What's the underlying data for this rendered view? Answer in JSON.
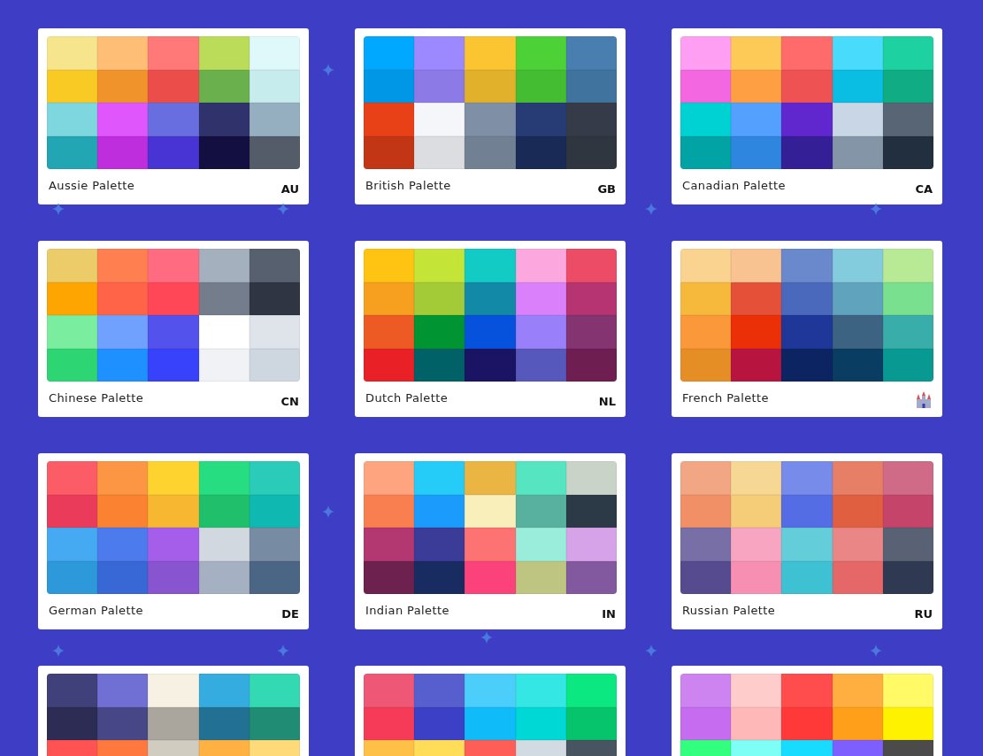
{
  "palettes": [
    {
      "label": "Aussie Palette",
      "badge": {
        "kind": "code",
        "text": "AU"
      },
      "rows": [
        [
          {
            "color": "#f6e58d"
          },
          {
            "color": "#ffbe76"
          },
          {
            "color": "#ff7979"
          },
          {
            "color": "#badc58"
          },
          {
            "color": "#dff9fb"
          }
        ],
        [
          {
            "color": "#f9ca24"
          },
          {
            "color": "#f0932b"
          },
          {
            "color": "#eb4d4b"
          },
          {
            "color": "#6ab04c"
          },
          {
            "color": "#c7ecee"
          }
        ],
        [
          {
            "color": "#7ed6df"
          },
          {
            "color": "#e056fd"
          },
          {
            "color": "#686de0"
          },
          {
            "color": "#30336b"
          },
          {
            "color": "#95afc0"
          }
        ],
        [
          {
            "color": "#22a6b3"
          },
          {
            "color": "#be2edd"
          },
          {
            "color": "#4834d4"
          },
          {
            "color": "#130f40"
          },
          {
            "color": "#535c68"
          }
        ]
      ]
    },
    {
      "label": "British Palette",
      "badge": {
        "kind": "code",
        "text": "GB"
      },
      "rows": [
        [
          {
            "color": "#00a8ff"
          },
          {
            "color": "#9c88ff"
          },
          {
            "color": "#fbc531"
          },
          {
            "color": "#4cd137"
          },
          {
            "color": "#487eb0"
          }
        ],
        [
          {
            "color": "#0097e6"
          },
          {
            "color": "#8c7ae6"
          },
          {
            "color": "#e1b12c"
          },
          {
            "color": "#44bd32"
          },
          {
            "color": "#40739e"
          }
        ],
        [
          {
            "color": "#e84118"
          },
          {
            "color": "#f5f6fa"
          },
          {
            "color": "#7f8fa6"
          },
          {
            "color": "#273c75"
          },
          {
            "color": "#353b48"
          }
        ],
        [
          {
            "color": "#c23616"
          },
          {
            "color": "#dcdde1"
          },
          {
            "color": "#718093"
          },
          {
            "color": "#192a56"
          },
          {
            "color": "#2f3640"
          }
        ]
      ]
    },
    {
      "label": "Canadian Palette",
      "badge": {
        "kind": "code",
        "text": "CA"
      },
      "rows": [
        [
          {
            "color": "#ff9ff3"
          },
          {
            "color": "#feca57"
          },
          {
            "color": "#ff6b6b"
          },
          {
            "color": "#48dbfb"
          },
          {
            "color": "#1dd1a1"
          }
        ],
        [
          {
            "color": "#f368e0"
          },
          {
            "color": "#ff9f43"
          },
          {
            "color": "#ee5253"
          },
          {
            "color": "#0abde3"
          },
          {
            "color": "#10ac84"
          }
        ],
        [
          {
            "color": "#00d2d3"
          },
          {
            "color": "#54a0ff"
          },
          {
            "color": "#5f27cd"
          },
          {
            "color": "#c8d6e5"
          },
          {
            "color": "#576574"
          }
        ],
        [
          {
            "color": "#01a3a4"
          },
          {
            "color": "#2e86de"
          },
          {
            "color": "#341f97"
          },
          {
            "color": "#8395a7"
          },
          {
            "color": "#222f3e"
          }
        ]
      ]
    },
    {
      "label": "Chinese Palette",
      "badge": {
        "kind": "code",
        "text": "CN"
      },
      "rows": [
        [
          {
            "color": "#eccc68"
          },
          {
            "color": "#ff7f50"
          },
          {
            "color": "#ff6b81"
          },
          {
            "color": "#a4b0be"
          },
          {
            "color": "#57606f"
          }
        ],
        [
          {
            "color": "#ffa502"
          },
          {
            "color": "#ff6348"
          },
          {
            "color": "#ff4757"
          },
          {
            "color": "#747d8c"
          },
          {
            "color": "#2f3542"
          }
        ],
        [
          {
            "color": "#7bed9f"
          },
          {
            "color": "#70a1ff"
          },
          {
            "color": "#5352ed"
          },
          {
            "color": "#ffffff"
          },
          {
            "color": "#dfe4ea"
          }
        ],
        [
          {
            "color": "#2ed573"
          },
          {
            "color": "#1e90ff"
          },
          {
            "color": "#3742fa"
          },
          {
            "color": "#f1f2f6"
          },
          {
            "color": "#ced6e0"
          }
        ]
      ]
    },
    {
      "label": "Dutch Palette",
      "badge": {
        "kind": "code",
        "text": "NL"
      },
      "rows": [
        [
          {
            "color": "#ffc312"
          },
          {
            "color": "#c4e538"
          },
          {
            "color": "#12cbc4"
          },
          {
            "color": "#fda7df"
          },
          {
            "color": "#ed4c67"
          }
        ],
        [
          {
            "color": "#f79f1f"
          },
          {
            "color": "#a3cb38"
          },
          {
            "color": "#1289a7"
          },
          {
            "color": "#d980fa"
          },
          {
            "color": "#b53471"
          }
        ],
        [
          {
            "color": "#ee5a24"
          },
          {
            "color": "#009432"
          },
          {
            "color": "#0652dd"
          },
          {
            "color": "#9980fa"
          },
          {
            "color": "#833471"
          }
        ],
        [
          {
            "color": "#ea2027"
          },
          {
            "color": "#006266"
          },
          {
            "color": "#1b1464"
          },
          {
            "color": "#5758bb"
          },
          {
            "color": "#6f1e51"
          }
        ]
      ]
    },
    {
      "label": "French Palette",
      "badge": {
        "kind": "castle"
      },
      "rows": [
        [
          {
            "color": "#fad390"
          },
          {
            "color": "#f8c291"
          },
          {
            "color": "#6a89cc"
          },
          {
            "color": "#82ccdd"
          },
          {
            "color": "#b8e994"
          }
        ],
        [
          {
            "color": "#f6b93b"
          },
          {
            "color": "#e55039"
          },
          {
            "color": "#4a69bd"
          },
          {
            "color": "#60a3bc"
          },
          {
            "color": "#78e08f"
          }
        ],
        [
          {
            "color": "#fa983a"
          },
          {
            "color": "#eb2f06"
          },
          {
            "color": "#1e3799"
          },
          {
            "color": "#3c6382"
          },
          {
            "color": "#38ada9"
          }
        ],
        [
          {
            "color": "#e58e26"
          },
          {
            "color": "#b71540"
          },
          {
            "color": "#0c2461"
          },
          {
            "color": "#0a3d62"
          },
          {
            "color": "#079992"
          }
        ]
      ]
    },
    {
      "label": "German Palette",
      "badge": {
        "kind": "code",
        "text": "DE"
      },
      "rows": [
        [
          {
            "color": "#fc5c65"
          },
          {
            "color": "#fd9644"
          },
          {
            "color": "#fed330"
          },
          {
            "color": "#26de81"
          },
          {
            "color": "#2bcbba"
          }
        ],
        [
          {
            "color": "#eb3b5a"
          },
          {
            "color": "#fa8231"
          },
          {
            "color": "#f7b731"
          },
          {
            "color": "#20bf6b"
          },
          {
            "color": "#0fb9b1"
          }
        ],
        [
          {
            "color": "#45aaf2"
          },
          {
            "color": "#4b7bec"
          },
          {
            "color": "#a55eea"
          },
          {
            "color": "#d1d8e0"
          },
          {
            "color": "#778ca3"
          }
        ],
        [
          {
            "color": "#2d98da"
          },
          {
            "color": "#3867d6"
          },
          {
            "color": "#8854d0"
          },
          {
            "color": "#a5b1c2"
          },
          {
            "color": "#4b6584"
          }
        ]
      ]
    },
    {
      "label": "Indian Palette",
      "badge": {
        "kind": "code",
        "text": "IN"
      },
      "rows": [
        [
          {
            "color": "#fea47f"
          },
          {
            "color": "#25ccf7"
          },
          {
            "color": "#eab543"
          },
          {
            "color": "#55e6c1"
          },
          {
            "color": "#cad3c8"
          }
        ],
        [
          {
            "color": "#f97f51"
          },
          {
            "color": "#1b9cfc"
          },
          {
            "color": "#f8efba"
          },
          {
            "color": "#58b19f"
          },
          {
            "color": "#2c3a47"
          }
        ],
        [
          {
            "color": "#b33771"
          },
          {
            "color": "#3b3b98"
          },
          {
            "color": "#fd7272"
          },
          {
            "color": "#9aecdb"
          },
          {
            "color": "#d6a2e8"
          }
        ],
        [
          {
            "color": "#6d214f"
          },
          {
            "color": "#182c61"
          },
          {
            "color": "#fc427b"
          },
          {
            "color": "#bdc581"
          },
          {
            "color": "#82589f"
          }
        ]
      ]
    },
    {
      "label": "Russian Palette",
      "badge": {
        "kind": "code",
        "text": "RU"
      },
      "rows": [
        [
          {
            "color": "#f3a683"
          },
          {
            "color": "#f7d794"
          },
          {
            "color": "#778beb"
          },
          {
            "color": "#e77f67"
          },
          {
            "color": "#cf6a87"
          }
        ],
        [
          {
            "color": "#f19066"
          },
          {
            "color": "#f5cd79"
          },
          {
            "color": "#546de5"
          },
          {
            "color": "#e15f41"
          },
          {
            "color": "#c44569"
          }
        ],
        [
          {
            "color": "#786fa6"
          },
          {
            "color": "#f8a5c2"
          },
          {
            "color": "#63cdda"
          },
          {
            "color": "#ea8685"
          },
          {
            "color": "#596275"
          }
        ],
        [
          {
            "color": "#574b90"
          },
          {
            "color": "#f78fb3"
          },
          {
            "color": "#3dc1d3"
          },
          {
            "color": "#e66767"
          },
          {
            "color": "#303952"
          }
        ]
      ]
    },
    {
      "rows": [
        [
          {
            "color": "#40407a"
          },
          {
            "color": "#706fd3"
          },
          {
            "color": "#f7f1e3"
          },
          {
            "color": "#34ace0"
          },
          {
            "color": "#33d9b2"
          }
        ],
        [
          {
            "color": "#2c2c54"
          },
          {
            "color": "#474787"
          },
          {
            "color": "#aaa69d"
          },
          {
            "color": "#227093"
          },
          {
            "color": "#218c74"
          }
        ],
        [
          {
            "color": "#ff5252"
          },
          {
            "color": "#ff793f"
          },
          {
            "color": "#d1ccc0"
          },
          {
            "color": "#ffb142"
          },
          {
            "color": "#ffda79"
          }
        ]
      ]
    },
    {
      "rows": [
        [
          {
            "color": "#ef5777"
          },
          {
            "color": "#575fcf"
          },
          {
            "color": "#4bcffa"
          },
          {
            "color": "#34e7e4"
          },
          {
            "color": "#0be881"
          }
        ],
        [
          {
            "color": "#f53b57"
          },
          {
            "color": "#3c40c6"
          },
          {
            "color": "#0fbcf9"
          },
          {
            "color": "#00d8d6"
          },
          {
            "color": "#05c46b"
          }
        ],
        [
          {
            "color": "#ffc048"
          },
          {
            "color": "#ffdd59"
          },
          {
            "color": "#ff5e57"
          },
          {
            "color": "#d2dae2"
          },
          {
            "color": "#485460"
          }
        ]
      ]
    },
    {
      "rows": [
        [
          {
            "color": "#cd84f1"
          },
          {
            "color": "#ffcccc"
          },
          {
            "color": "#ff4d4d"
          },
          {
            "color": "#ffaf40"
          },
          {
            "color": "#fffa65"
          }
        ],
        [
          {
            "color": "#c56cf0"
          },
          {
            "color": "#ffb8b8"
          },
          {
            "color": "#ff3838"
          },
          {
            "color": "#ff9f1a"
          },
          {
            "color": "#fff200"
          }
        ],
        [
          {
            "color": "#32ff7e"
          },
          {
            "color": "#7efff5"
          },
          {
            "color": "#18dcff"
          },
          {
            "color": "#7d5fff"
          },
          {
            "color": "#4b4b4b"
          }
        ]
      ]
    }
  ]
}
